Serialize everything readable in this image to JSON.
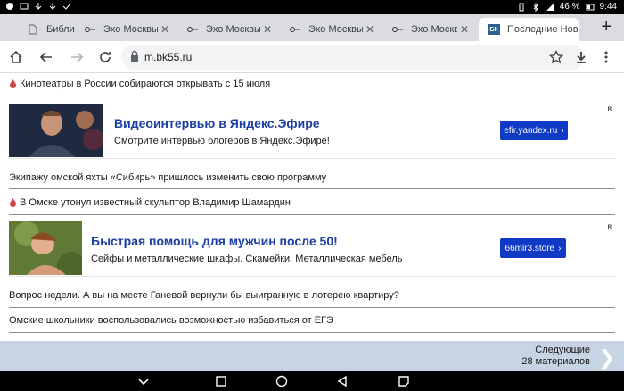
{
  "status": {
    "battery": "46 %",
    "time": "9:44"
  },
  "tabs": [
    {
      "label": "Библиотеки",
      "active": false,
      "icon": "page-icon"
    },
    {
      "label": "Эхо Москвы - н",
      "active": false,
      "icon": "echo-icon"
    },
    {
      "label": "Эхо Москвы - н",
      "active": false,
      "icon": "echo-icon"
    },
    {
      "label": "Эхо Москвы - н",
      "active": false,
      "icon": "echo-icon"
    },
    {
      "label": "Эхо Москвы - н",
      "active": false,
      "icon": "echo-icon"
    },
    {
      "label": "Последние Нов",
      "active": true,
      "icon": "bk-icon"
    }
  ],
  "toolbar": {
    "url": "m.bk55.ru"
  },
  "feed": {
    "item1": "Кинотеатры в России собираются открывать с 15 июля",
    "ad1": {
      "title": "Видеоинтервью в Яндекс.Эфире",
      "desc": "Смотрите интервью блогеров в Яндекс.Эфире!",
      "cta": "efir.yandex.ru",
      "mark": "ᴿ"
    },
    "item2": "Экипажу омской яхты «Сибирь» пришлось изменить свою программу",
    "item3": "В Омске утонул известный скульптор Владимир Шамардин",
    "ad2": {
      "title": "Быстрая помощь для мужчин после 50!",
      "desc": "Сейфы и металлические шкафы. Скамейки. Металлическая мебель",
      "cta": "66mir3.store",
      "mark": "ᴿ"
    },
    "item4": "Вопрос недели. А вы на месте Ганевой вернули бы выигранную в лотерею квартиру?",
    "item5": "Омские школьники воспользовались возможностью избавиться от ЕГЭ"
  },
  "next": {
    "line1": "Следующие",
    "line2": "28 материалов"
  },
  "colors": {
    "ad_title": "#1d3fa3",
    "cta_bg": "#0e3ac6",
    "next_bar": "#c7d4e3"
  }
}
